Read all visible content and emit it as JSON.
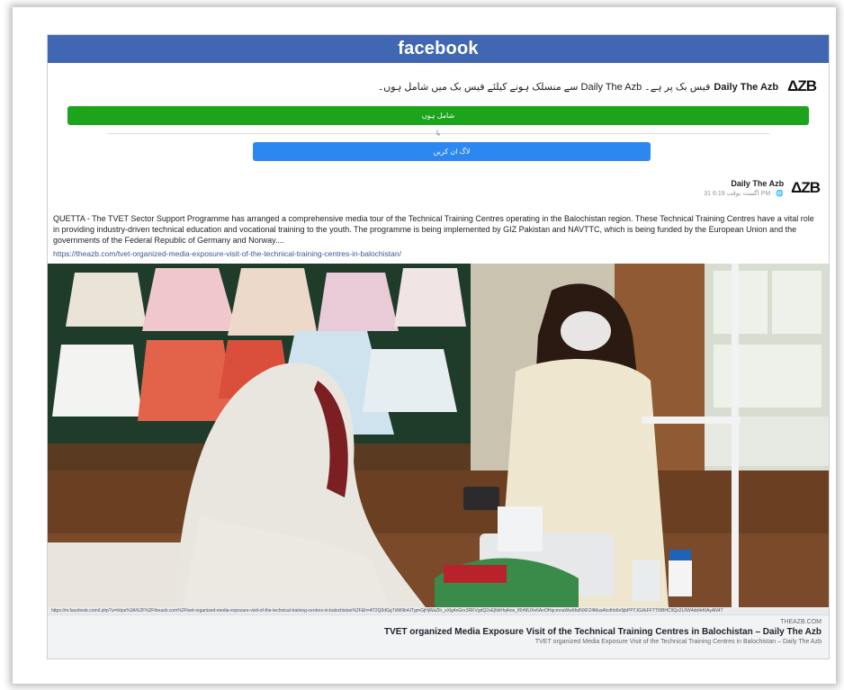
{
  "header": {
    "brand": "facebook"
  },
  "invite": {
    "logo": "ΔZB",
    "page_name": "Daily The Azb",
    "message": "فیس بک پر ہے۔ Daily The Azb سے منسلک ہونے کیلئے فیس بک میں شامل ہوں۔"
  },
  "buttons": {
    "join": "شامل ہوں",
    "or": "یا",
    "login": "لاگ ان کریں"
  },
  "post": {
    "logo": "ΔZB",
    "page_name": "Daily The Azb",
    "time": "31 اگست بوقت 6:19 PM · 🌐",
    "text": "QUETTA - The TVET Sector Support Programme has arranged a comprehensive media tour of the Technical Training Centres operating in the Balochistan region. These Technical Training Centres have a vital role in providing industry-driven technical education and vocational training to the youth. The programme is being implemented by GIZ Pakistan and NAVTTC, which is being funded by the European Union and the governments of the Federal Republic of Germany and Norway....",
    "link": "https://theazb.com/tvet-organized-media-exposure-visit-of-the-technical-training-centres-in-balochistan/"
  },
  "url_strip": "https://m.facebook.com/l.php?u=https%3A%2F%2Ftheazb.com%2Ftvet-organized-media-exposure-visit-of-the-technical-training-centres-in-balochistan%2F&h=AT2Q0dGgTdW9b4JTgmGjHjWaZlIr_sXlg4nGnr3RKVgdQ2sEjNbHq4oie_fI0rMUXe6AnOHqcmnaWw6hdNXFZ4Mua4tcdhb6o5jbPP7JGXkFFTTI9BHC9Qz2L6W4dd4rKlAyAN4T",
  "preview": {
    "domain": "THEAZB.COM",
    "title": "TVET organized Media Exposure Visit of the Technical Training Centres in Balochistan – Daily The Azb",
    "description": "TVET organized Media Exposure Visit of the Technical Training Centres in Balochistan – Daily The Azb"
  },
  "photo": {
    "description_icon": "photo-image"
  },
  "colors": {
    "header_blue": "#4267b2",
    "join_green": "#1ca41c",
    "login_blue": "#2d87f0",
    "link": "#385898"
  }
}
